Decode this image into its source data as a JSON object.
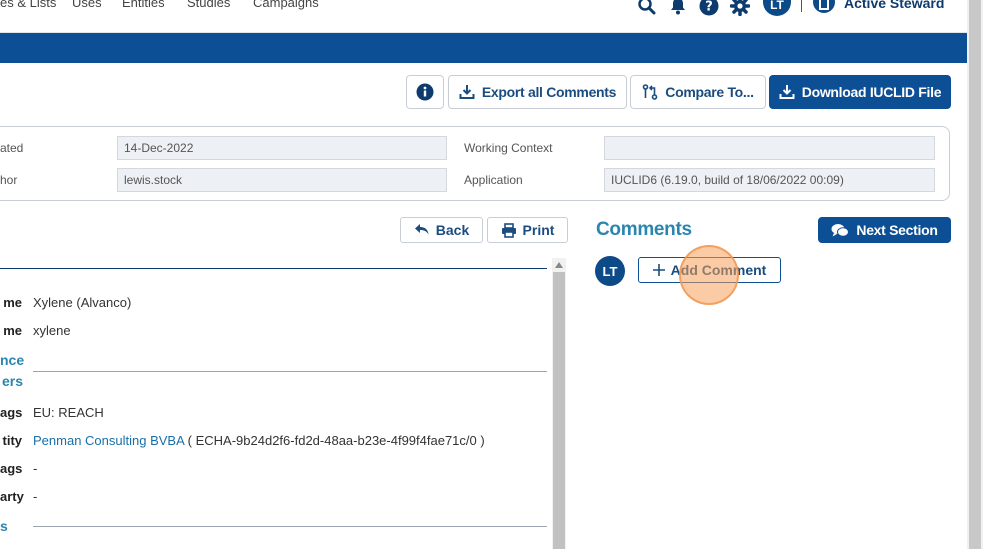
{
  "nav": {
    "links": [
      "es & Lists",
      "Uses",
      "Entities",
      "Studies",
      "Campaigns"
    ],
    "avatar_initials": "LT",
    "steward_label": "Active Steward"
  },
  "toolbar": {
    "info_icon": "info-icon",
    "export_label": "Export all Comments",
    "compare_label": "Compare To...",
    "download_label": "Download IUCLID File"
  },
  "info": {
    "created_label": "ated",
    "created_value": "14-Dec-2022",
    "author_label": "hor",
    "author_value": "lewis.stock",
    "working_context_label": "Working Context",
    "working_context_value": "",
    "application_label": "Application",
    "application_value": "IUCLID6 (6.19.0, build of 18/06/2022 00:09)"
  },
  "detail": {
    "back_label": "Back",
    "print_label": "Print",
    "rows": [
      {
        "label": "me",
        "value": "Xylene (Alvanco)"
      },
      {
        "label": "me",
        "value": "xylene"
      }
    ],
    "section1_line1": "nce",
    "section1_line2": "ers",
    "rows2": [
      {
        "label": "ags",
        "value": "EU: REACH"
      },
      {
        "label": "tity",
        "link": "Penman Consulting BVBA",
        "value": " ( ECHA-9b24d2f6-fd2d-48aa-b23e-4f99f4fae71c/0 )"
      },
      {
        "label": "ags",
        "value": "-"
      },
      {
        "label": "arty",
        "value": "-"
      }
    ],
    "section2": "s"
  },
  "comments": {
    "title": "Comments",
    "next_section_label": "Next Section",
    "avatar_initials": "LT",
    "add_comment_label": "Add Comment"
  },
  "colors": {
    "brand_blue": "#0d4f95",
    "teal_heading": "#2a86b0"
  }
}
